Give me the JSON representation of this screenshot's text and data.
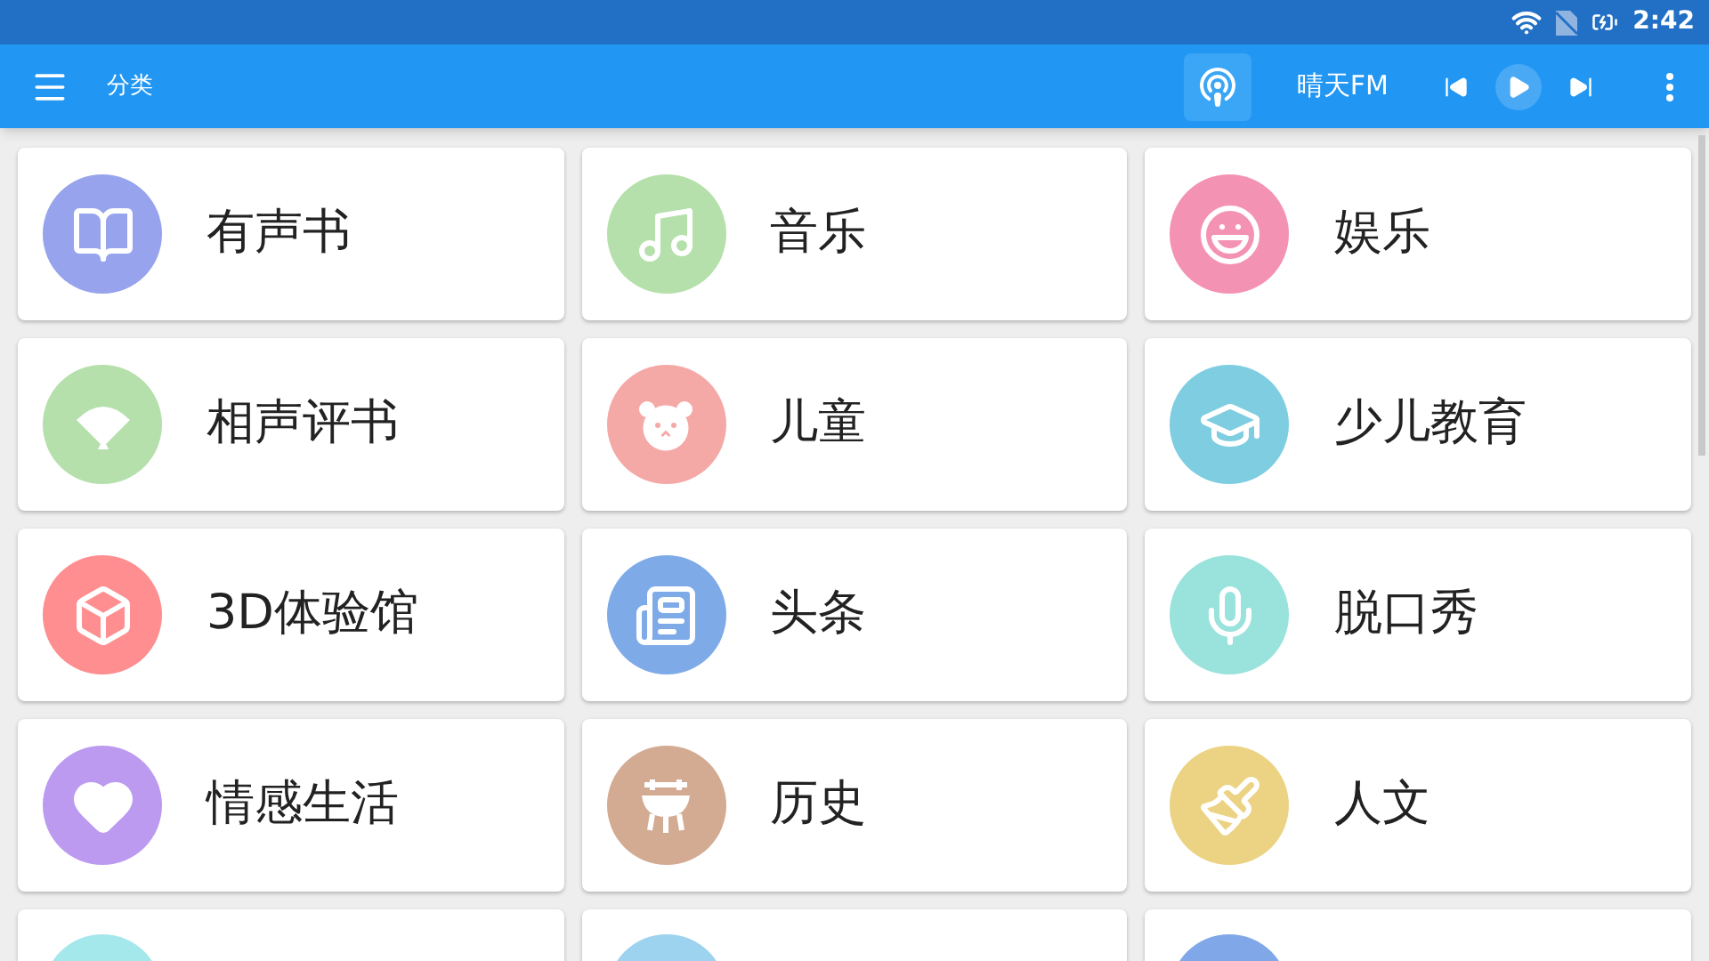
{
  "status_bar": {
    "time": "2:42"
  },
  "app_bar": {
    "title": "分类",
    "station": "晴天FM",
    "radio_selected": true
  },
  "categories": [
    {
      "label": "有声书",
      "color": "#97a3ec"
    },
    {
      "label": "音乐",
      "color": "#b5e0ab"
    },
    {
      "label": "娱乐",
      "color": "#f492b4"
    },
    {
      "label": "相声评书",
      "color": "#b5e0ab"
    },
    {
      "label": "儿童",
      "color": "#f5a9a6"
    },
    {
      "label": "少儿教育",
      "color": "#7ecde0"
    },
    {
      "label": "3D体验馆",
      "color": "#fe8e8f"
    },
    {
      "label": "头条",
      "color": "#7eabe8"
    },
    {
      "label": "脱口秀",
      "color": "#99e3dc"
    },
    {
      "label": "情感生活",
      "color": "#bb9af0"
    },
    {
      "label": "历史",
      "color": "#d3ab92"
    },
    {
      "label": "人文",
      "color": "#ebd383"
    }
  ],
  "partial_cards": [
    {
      "color": "#a5e8ec"
    },
    {
      "color": "#9dd3ee"
    },
    {
      "color": "#80a8e8"
    }
  ]
}
